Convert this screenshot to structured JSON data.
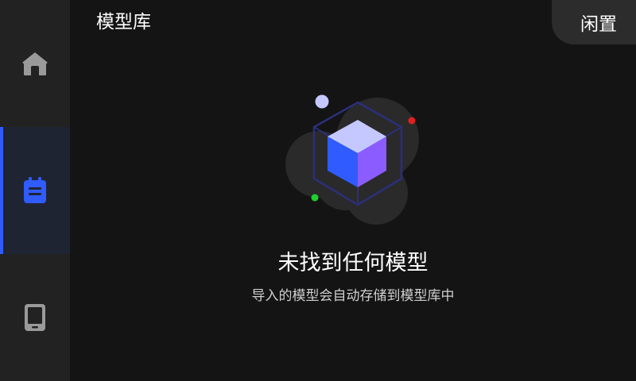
{
  "header": {
    "title": "模型库",
    "status_label": "闲置"
  },
  "sidebar": {
    "items": [
      {
        "id": "home",
        "icon": "home-icon",
        "active": false
      },
      {
        "id": "library",
        "icon": "calendar-list-icon",
        "active": true
      },
      {
        "id": "device",
        "icon": "tablet-icon",
        "active": false
      }
    ]
  },
  "empty_state": {
    "title": "未找到任何模型",
    "subtitle": "导入的模型会自动存储到模型库中",
    "illustration": "cube-icon"
  },
  "colors": {
    "accent": "#2f5bff",
    "sidebar_bg": "#222222",
    "active_item_bg": "#1f2433",
    "background": "#141414",
    "cube_left": "#2f5bff",
    "cube_right": "#8b5cff",
    "cube_top": "#c4c8ff",
    "dot_red": "#e02020",
    "dot_green": "#1fcf2f",
    "dot_lavender": "#c4c8ff"
  }
}
